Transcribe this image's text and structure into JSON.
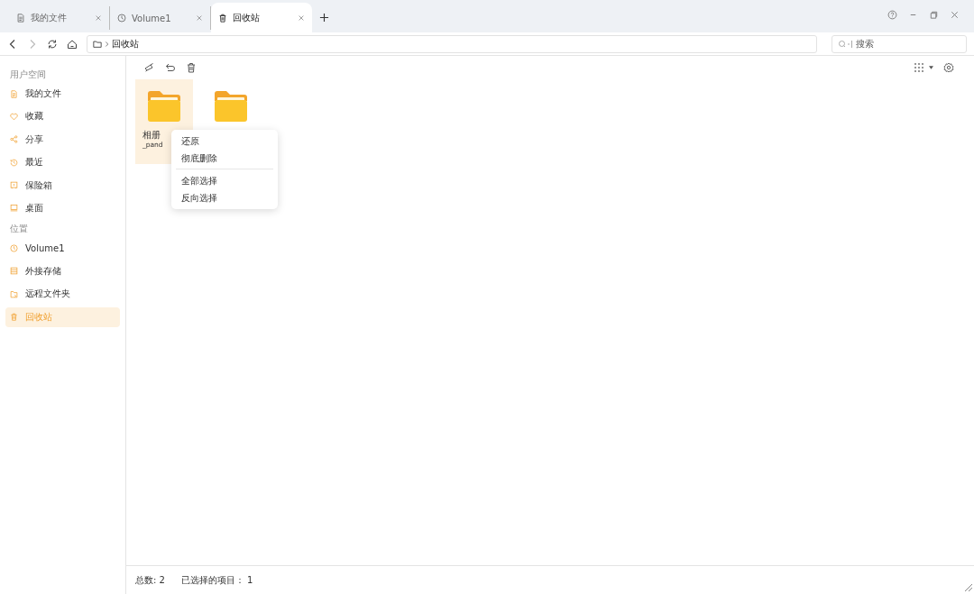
{
  "tabs": [
    {
      "label": "我的文件",
      "kind": "doc",
      "selected": false
    },
    {
      "label": "Volume1",
      "kind": "clock",
      "selected": false
    },
    {
      "label": "回收站",
      "kind": "trash",
      "selected": true
    }
  ],
  "address": {
    "path": "回收站"
  },
  "search": {
    "placeholder": "搜索"
  },
  "sidebar": {
    "sections": [
      {
        "title": "用户空间",
        "items": [
          {
            "label": "我的文件",
            "kind": "doc",
            "selected": false
          },
          {
            "label": "收藏",
            "kind": "heart",
            "selected": false
          },
          {
            "label": "分享",
            "kind": "share",
            "selected": false
          },
          {
            "label": "最近",
            "kind": "history",
            "selected": false
          },
          {
            "label": "保险箱",
            "kind": "safe",
            "selected": false
          },
          {
            "label": "桌面",
            "kind": "desktop",
            "selected": false
          }
        ]
      },
      {
        "title": "位置",
        "items": [
          {
            "label": "Volume1",
            "kind": "clock",
            "selected": false
          },
          {
            "label": "外接存储",
            "kind": "storage",
            "selected": false
          },
          {
            "label": "远程文件夹",
            "kind": "remote",
            "selected": false
          },
          {
            "label": "回收站",
            "kind": "trash",
            "selected": true
          }
        ]
      }
    ]
  },
  "files": [
    {
      "name_lines": [
        "相册",
        "_pand"
      ],
      "selected": true
    },
    {
      "selected": false
    }
  ],
  "context_menu": {
    "groups": [
      [
        "还原",
        "彻底删除"
      ],
      [
        "全部选择",
        "反向选择"
      ]
    ]
  },
  "status_bar": {
    "total": "总数: 2",
    "selected": "已选择的项目： 1"
  }
}
